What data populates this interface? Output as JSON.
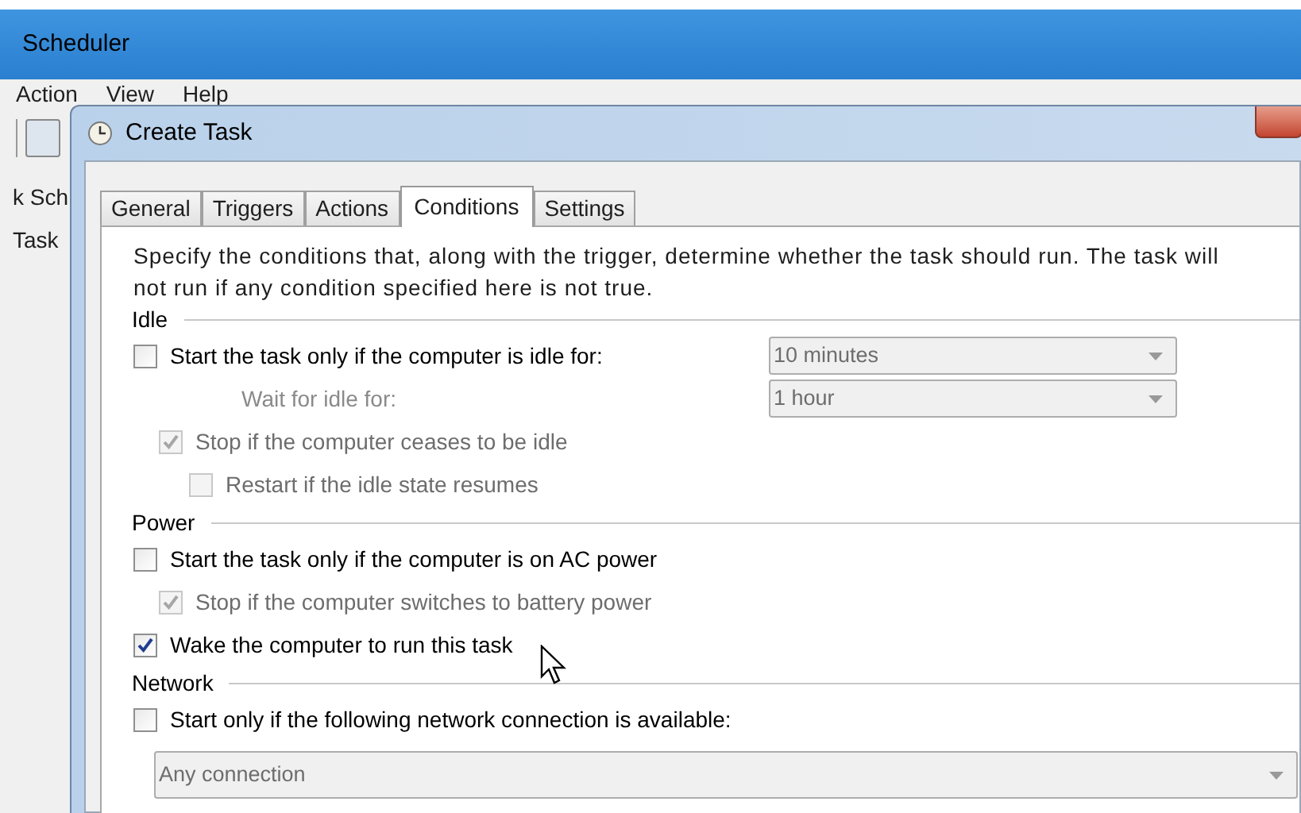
{
  "main_window": {
    "title": "Scheduler",
    "menu": [
      "Action",
      "View",
      "Help"
    ],
    "tree": [
      "k Sch",
      "Task"
    ]
  },
  "dialog": {
    "title": "Create Task",
    "tabs": [
      {
        "label": "General",
        "selected": false
      },
      {
        "label": "Triggers",
        "selected": false
      },
      {
        "label": "Actions",
        "selected": false
      },
      {
        "label": "Conditions",
        "selected": true
      },
      {
        "label": "Settings",
        "selected": false
      }
    ],
    "description": "Specify the conditions that, along with the trigger, determine whether the task should run.  The task will not run  if any condition specified here is not true.",
    "sections": [
      {
        "title": "Idle",
        "items": [
          {
            "kind": "checkbox",
            "label": "Start the task only if the computer is idle for:",
            "checked": false,
            "disabled": false,
            "dropdown": {
              "value": "10 minutes",
              "disabled": true
            },
            "children": [
              {
                "kind": "label",
                "label": "Wait for idle for:",
                "disabled": true,
                "dropdown": {
                  "value": "1 hour",
                  "disabled": true
                }
              },
              {
                "kind": "checkbox",
                "label": "Stop if the computer ceases to be idle",
                "checked": true,
                "disabled": true,
                "children": [
                  {
                    "kind": "checkbox",
                    "label": "Restart if the idle state resumes",
                    "checked": false,
                    "disabled": true
                  }
                ]
              }
            ]
          }
        ]
      },
      {
        "title": "Power",
        "items": [
          {
            "kind": "checkbox",
            "label": "Start the task only if the computer is on AC power",
            "checked": false,
            "disabled": false,
            "children": [
              {
                "kind": "checkbox",
                "label": "Stop if the computer switches to battery power",
                "checked": true,
                "disabled": true
              }
            ]
          },
          {
            "kind": "checkbox",
            "label": "Wake the computer to run this task",
            "checked": true,
            "disabled": false
          }
        ]
      },
      {
        "title": "Network",
        "items": [
          {
            "kind": "checkbox",
            "label": "Start only if the following network connection is available:",
            "checked": false,
            "disabled": false
          },
          {
            "kind": "wide_dropdown",
            "dropdown": {
              "value": "Any connection",
              "disabled": true
            }
          }
        ]
      }
    ]
  }
}
